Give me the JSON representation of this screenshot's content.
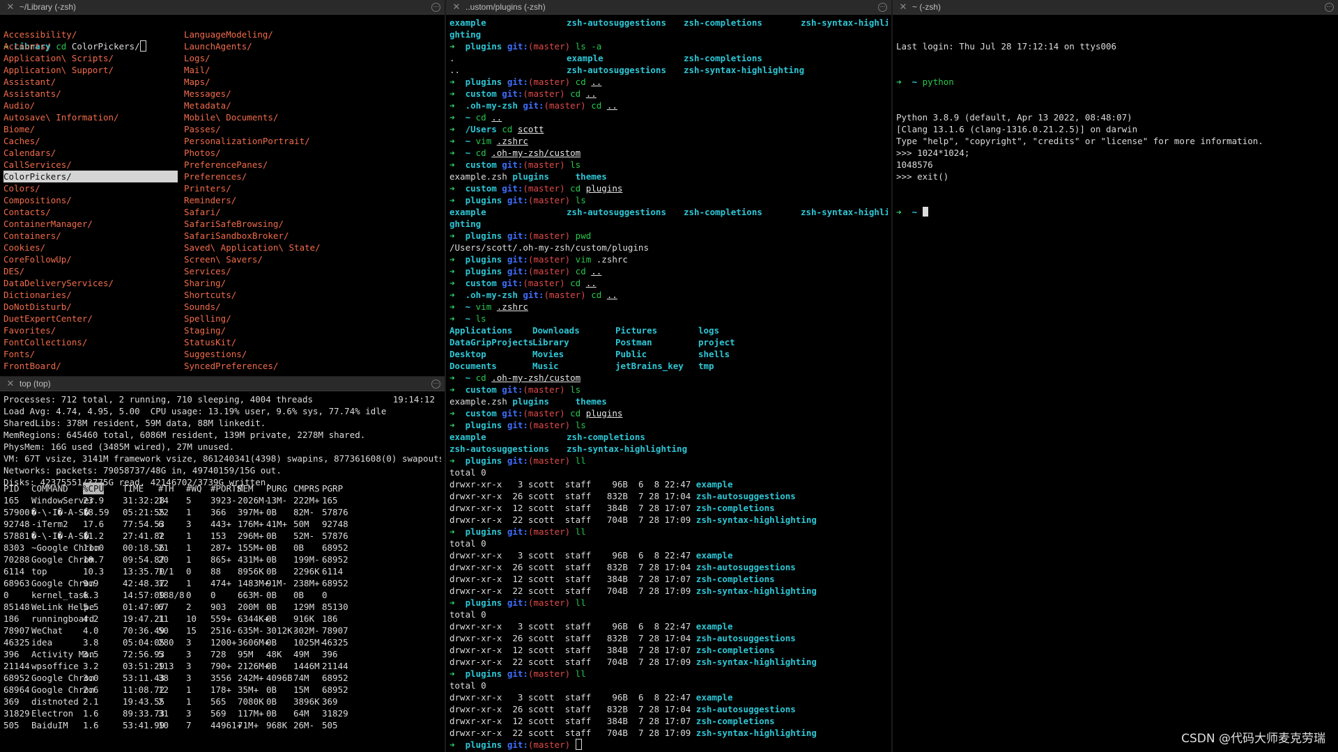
{
  "panes": {
    "library": {
      "title": "~/Library (-zsh)"
    },
    "top": {
      "title": "top (top)"
    },
    "plugins": {
      "title": "..ustom/plugins (-zsh)"
    },
    "python": {
      "title": "~ (-zsh)"
    }
  },
  "library": {
    "prompt_dir": "Library",
    "prompt_cmd": "cd",
    "prompt_arg": "ColorPickers/",
    "col1": [
      "Accessibility/",
      "Accounts/",
      "Application\\ Scripts/",
      "Application\\ Support/",
      "Assistant/",
      "Assistants/",
      "Audio/",
      "Autosave\\ Information/",
      "Biome/",
      "Caches/",
      "Calendars/",
      "CallServices/",
      "ColorPickers/",
      "Colors/",
      "Compositions/",
      "Contacts/",
      "ContainerManager/",
      "Containers/",
      "Cookies/",
      "CoreFollowUp/",
      "DES/",
      "DataDeliveryServices/",
      "Dictionaries/",
      "DoNotDisturb/",
      "DuetExpertCenter/",
      "Favorites/",
      "FontCollections/",
      "Fonts/",
      "FrontBoard/"
    ],
    "col2": [
      "LanguageModeling/",
      "LaunchAgents/",
      "Logs/",
      "Mail/",
      "Maps/",
      "Messages/",
      "Metadata/",
      "Mobile\\ Documents/",
      "Passes/",
      "PersonalizationPortrait/",
      "Photos/",
      "PreferencePanes/",
      "Preferences/",
      "Printers/",
      "Reminders/",
      "Safari/",
      "SafariSafeBrowsing/",
      "SafariSandboxBroker/",
      "Saved\\ Application\\ State/",
      "Screen\\ Savers/",
      "Services/",
      "Sharing/",
      "Shortcuts/",
      "Sounds/",
      "Spelling/",
      "Staging/",
      "StatusKit/",
      "Suggestions/",
      "SyncedPreferences/"
    ],
    "selected_index": 12
  },
  "top": {
    "summary": [
      "Processes: 712 total, 2 running, 710 sleeping, 4004 threads",
      "Load Avg: 4.74, 4.95, 5.00  CPU usage: 13.19% user, 9.6% sys, 77.74% idle",
      "SharedLibs: 378M resident, 59M data, 88M linkedit.",
      "MemRegions: 645460 total, 6086M resident, 139M private, 2278M shared.",
      "PhysMem: 16G used (3485M wired), 27M unused.",
      "VM: 67T vsize, 3141M framework vsize, 861240341(4398) swapins, 877361608(0) swapouts.",
      "Networks: packets: 79058737/48G in, 49740159/15G out.",
      "Disks: 42375551/3775G read, 42146702/3739G written."
    ],
    "time": "19:14:12",
    "headers": [
      "PID",
      "COMMAND",
      "%CPU",
      "TIME",
      "#TH",
      "#WQ",
      "#PORTS",
      "MEM",
      "PURG",
      "CMPRS",
      "PGRP"
    ],
    "rows": [
      [
        "165",
        "WindowServer",
        "23.9",
        "31:32:28",
        "14",
        "5",
        "3923-",
        "2026M-",
        "13M-",
        "222M+",
        "165"
      ],
      [
        "57900",
        "�-\\-I�-A-S�",
        "18.59",
        "05:21:55",
        "22",
        "1",
        "366",
        "397M+",
        "0B",
        "82M-",
        "57876"
      ],
      [
        "92748",
        "-iTerm2",
        "17.6",
        "77:54.53",
        "6",
        "3",
        "443+",
        "176M+",
        "41M+",
        "50M",
        "92748"
      ],
      [
        "57881",
        "�-\\-I�-A-S�",
        "11.2",
        "27:41.82",
        "7",
        "1",
        "153",
        "296M+",
        "0B",
        "52M-",
        "57876"
      ],
      [
        "8303",
        "~Google Chrom",
        "11.0",
        "00:18.56",
        "21",
        "1",
        "287+",
        "155M+",
        "0B",
        "0B",
        "68952"
      ],
      [
        "70288",
        "Google Chrom",
        "10.7",
        "09:54.87",
        "20",
        "1",
        "865+",
        "431M+",
        "0B",
        "199M-",
        "68952"
      ],
      [
        "6114",
        "top",
        "10.3",
        "13:35.70",
        "1/1",
        "0",
        "88",
        "8956K",
        "0B",
        "2296K",
        "6114"
      ],
      [
        "68963",
        "Google Chrom",
        "9.9",
        "42:48.37",
        "12",
        "1",
        "474+",
        "1483M+",
        "91M-",
        "238M+",
        "68952"
      ],
      [
        "0",
        "kernel_task",
        "6.3",
        "14:57:09",
        "188/8",
        "0",
        "0",
        "663M-",
        "0B",
        "0B",
        "0"
      ],
      [
        "85148",
        "WeLink Helpe",
        "5.5",
        "01:47:07",
        "67",
        "2",
        "903",
        "200M",
        "0B",
        "129M",
        "85130"
      ],
      [
        "186",
        "runningboard",
        "4.2",
        "19:47.21",
        "11",
        "10",
        "559+",
        "6344K+",
        "0B",
        "916K",
        "186"
      ],
      [
        "78907",
        "WeChat",
        "4.0",
        "70:36.49",
        "50",
        "15",
        "2516-",
        "635M-",
        "3012K-",
        "302M-",
        "78907"
      ],
      [
        "46325",
        "idea",
        "3.8",
        "05:04:05",
        "280",
        "3",
        "1200+",
        "3606M+",
        "0B",
        "1025M-",
        "46325"
      ],
      [
        "396",
        "Activity Mon",
        "3.5",
        "72:56.93",
        "5",
        "3",
        "728",
        "95M",
        "48K",
        "49M",
        "396"
      ],
      [
        "21144",
        "wpsoffice",
        "3.2",
        "03:51:29",
        "113",
        "3",
        "790+",
        "2126M+",
        "0B",
        "1446M",
        "21144"
      ],
      [
        "68952",
        "Google Chrom",
        "3.0",
        "53:11.43",
        "38",
        "3",
        "3556",
        "242M+",
        "4096B",
        "74M",
        "68952"
      ],
      [
        "68964",
        "Google Chrom",
        "2.6",
        "11:08.72",
        "12",
        "1",
        "178+",
        "35M+",
        "0B",
        "15M",
        "68952"
      ],
      [
        "369",
        "distnoted",
        "2.1",
        "19:43.55",
        "2",
        "1",
        "565",
        "7080K",
        "0B",
        "3896K",
        "369"
      ],
      [
        "31829",
        "Electron",
        "1.6",
        "89:33.73",
        "31",
        "3",
        "569",
        "117M+",
        "0B",
        "64M",
        "31829"
      ],
      [
        "505",
        "BaiduIM",
        "1.6",
        "53:41.99",
        "10",
        "7",
        "44961+",
        "71M+",
        "968K",
        "26M-",
        "505"
      ]
    ]
  },
  "plugins": {
    "head_ls_a": [
      "example",
      "zsh-autosuggestions",
      "zsh-completions",
      "zsh-syntax-highli"
    ],
    "head_wrap": "ghting",
    "lines": [
      {
        "t": "p",
        "dir": "plugins",
        "git": true,
        "cmd": "ls -a"
      },
      {
        "t": "ls4",
        "items": [
          ".",
          "example",
          "zsh-completions",
          ""
        ]
      },
      {
        "t": "ls4",
        "items": [
          "..",
          "zsh-autosuggestions",
          "zsh-syntax-highlighting",
          ""
        ]
      },
      {
        "t": "p",
        "dir": "plugins",
        "git": true,
        "cmd": "cd",
        "arg": ".."
      },
      {
        "t": "p",
        "dir": "custom",
        "git": true,
        "cmd": "cd",
        "arg": ".."
      },
      {
        "t": "p",
        "dir": ".oh-my-zsh",
        "git": true,
        "cmd": "cd",
        "arg": ".."
      },
      {
        "t": "p",
        "dir": "~",
        "cmd": "cd",
        "arg": ".."
      },
      {
        "t": "p",
        "dir": "/Users",
        "cmd": "cd",
        "arg": "scott"
      },
      {
        "t": "p",
        "dir": "~",
        "cmd": "vim",
        "arg": ".zshrc"
      },
      {
        "t": "p",
        "dir": "~",
        "cmd": "cd",
        "arg": ".oh-my-zsh/custom"
      },
      {
        "t": "p",
        "dir": "custom",
        "git": true,
        "cmd": "ls"
      },
      {
        "t": "mix",
        "parts": [
          "example.zsh ",
          "plugins",
          "themes"
        ]
      },
      {
        "t": "p",
        "dir": "custom",
        "git": true,
        "cmd": "cd",
        "arg": "plugins"
      },
      {
        "t": "p",
        "dir": "plugins",
        "git": true,
        "cmd": "ls"
      },
      {
        "t": "ls4",
        "items": [
          "example",
          "zsh-autosuggestions",
          "zsh-completions",
          "zsh-syntax-highli"
        ]
      },
      {
        "t": "dirtxt",
        "text": "ghting"
      },
      {
        "t": "p",
        "dir": "plugins",
        "git": true,
        "cmd": "pwd"
      },
      {
        "t": "txt",
        "text": "/Users/scott/.oh-my-zsh/custom/plugins"
      },
      {
        "t": "p",
        "dir": "plugins",
        "git": true,
        "cmd": "vim",
        "arg": ".zshrc",
        "argplain": true
      },
      {
        "t": "p",
        "dir": "plugins",
        "git": true,
        "cmd": "cd",
        "arg": ".."
      },
      {
        "t": "p",
        "dir": "custom",
        "git": true,
        "cmd": "cd",
        "arg": ".."
      },
      {
        "t": "p",
        "dir": ".oh-my-zsh",
        "git": true,
        "cmd": "cd",
        "arg": ".."
      },
      {
        "t": "p",
        "dir": "~",
        "cmd": "vim",
        "arg": ".zshrc"
      },
      {
        "t": "p",
        "dir": "~",
        "cmd": "ls"
      },
      {
        "t": "ls4",
        "items": [
          "Applications",
          "Downloads",
          "Pictures",
          "logs"
        ]
      },
      {
        "t": "ls4",
        "items": [
          "DataGripProjects",
          "Library",
          "Postman",
          "project"
        ]
      },
      {
        "t": "ls4",
        "items": [
          "Desktop",
          "Movies",
          "Public",
          "shells"
        ]
      },
      {
        "t": "ls4",
        "items": [
          "Documents",
          "Music",
          "jetBrains_key",
          "tmp"
        ]
      },
      {
        "t": "p",
        "dir": "~",
        "cmd": "cd",
        "arg": ".oh-my-zsh/custom"
      },
      {
        "t": "p",
        "dir": "custom",
        "git": true,
        "cmd": "ls"
      },
      {
        "t": "mix",
        "parts": [
          "example.zsh ",
          "plugins",
          "themes"
        ]
      },
      {
        "t": "p",
        "dir": "custom",
        "git": true,
        "cmd": "cd",
        "arg": "plugins"
      },
      {
        "t": "p",
        "dir": "plugins",
        "git": true,
        "cmd": "ls"
      },
      {
        "t": "ls2",
        "items": [
          "example",
          "zsh-completions"
        ]
      },
      {
        "t": "ls2",
        "items": [
          "zsh-autosuggestions",
          "zsh-syntax-highlighting"
        ]
      },
      {
        "t": "p",
        "dir": "plugins",
        "git": true,
        "cmd": "ll"
      },
      {
        "t": "txt",
        "text": "total 0"
      },
      {
        "t": "ll",
        "perm": "drwxr-xr-x",
        "n": "3",
        "user": "scott",
        "grp": "staff",
        "size": "96B",
        "date": "6  8 22:47",
        "name": "example"
      },
      {
        "t": "ll",
        "perm": "drwxr-xr-x",
        "n": "26",
        "user": "scott",
        "grp": "staff",
        "size": "832B",
        "date": "7 28 17:04",
        "name": "zsh-autosuggestions"
      },
      {
        "t": "ll",
        "perm": "drwxr-xr-x",
        "n": "12",
        "user": "scott",
        "grp": "staff",
        "size": "384B",
        "date": "7 28 17:07",
        "name": "zsh-completions"
      },
      {
        "t": "ll",
        "perm": "drwxr-xr-x",
        "n": "22",
        "user": "scott",
        "grp": "staff",
        "size": "704B",
        "date": "7 28 17:09",
        "name": "zsh-syntax-highlighting"
      },
      {
        "t": "p",
        "dir": "plugins",
        "git": true,
        "cmd": "ll"
      },
      {
        "t": "txt",
        "text": "total 0"
      },
      {
        "t": "ll",
        "perm": "drwxr-xr-x",
        "n": "3",
        "user": "scott",
        "grp": "staff",
        "size": "96B",
        "date": "6  8 22:47",
        "name": "example"
      },
      {
        "t": "ll",
        "perm": "drwxr-xr-x",
        "n": "26",
        "user": "scott",
        "grp": "staff",
        "size": "832B",
        "date": "7 28 17:04",
        "name": "zsh-autosuggestions"
      },
      {
        "t": "ll",
        "perm": "drwxr-xr-x",
        "n": "12",
        "user": "scott",
        "grp": "staff",
        "size": "384B",
        "date": "7 28 17:07",
        "name": "zsh-completions"
      },
      {
        "t": "ll",
        "perm": "drwxr-xr-x",
        "n": "22",
        "user": "scott",
        "grp": "staff",
        "size": "704B",
        "date": "7 28 17:09",
        "name": "zsh-syntax-highlighting"
      },
      {
        "t": "p",
        "dir": "plugins",
        "git": true,
        "cmd": "ll"
      },
      {
        "t": "txt",
        "text": "total 0"
      },
      {
        "t": "ll",
        "perm": "drwxr-xr-x",
        "n": "3",
        "user": "scott",
        "grp": "staff",
        "size": "96B",
        "date": "6  8 22:47",
        "name": "example"
      },
      {
        "t": "ll",
        "perm": "drwxr-xr-x",
        "n": "26",
        "user": "scott",
        "grp": "staff",
        "size": "832B",
        "date": "7 28 17:04",
        "name": "zsh-autosuggestions"
      },
      {
        "t": "ll",
        "perm": "drwxr-xr-x",
        "n": "12",
        "user": "scott",
        "grp": "staff",
        "size": "384B",
        "date": "7 28 17:07",
        "name": "zsh-completions"
      },
      {
        "t": "ll",
        "perm": "drwxr-xr-x",
        "n": "22",
        "user": "scott",
        "grp": "staff",
        "size": "704B",
        "date": "7 28 17:09",
        "name": "zsh-syntax-highlighting"
      },
      {
        "t": "p",
        "dir": "plugins",
        "git": true,
        "cmd": "ll"
      },
      {
        "t": "txt",
        "text": "total 0"
      },
      {
        "t": "ll",
        "perm": "drwxr-xr-x",
        "n": "3",
        "user": "scott",
        "grp": "staff",
        "size": "96B",
        "date": "6  8 22:47",
        "name": "example"
      },
      {
        "t": "ll",
        "perm": "drwxr-xr-x",
        "n": "26",
        "user": "scott",
        "grp": "staff",
        "size": "832B",
        "date": "7 28 17:04",
        "name": "zsh-autosuggestions"
      },
      {
        "t": "ll",
        "perm": "drwxr-xr-x",
        "n": "12",
        "user": "scott",
        "grp": "staff",
        "size": "384B",
        "date": "7 28 17:07",
        "name": "zsh-completions"
      },
      {
        "t": "ll",
        "perm": "drwxr-xr-x",
        "n": "22",
        "user": "scott",
        "grp": "staff",
        "size": "704B",
        "date": "7 28 17:09",
        "name": "zsh-syntax-highlighting"
      },
      {
        "t": "pcur",
        "dir": "plugins",
        "git": true
      }
    ],
    "git_label": "git:",
    "git_branch": "(master)"
  },
  "python": {
    "last_login": "Last login: Thu Jul 28 17:12:14 on ttys006",
    "prompt1_dir": "~",
    "prompt1_cmd": "python",
    "lines": [
      "Python 3.8.9 (default, Apr 13 2022, 08:48:07)",
      "[Clang 13.1.6 (clang-1316.0.21.2.5)] on darwin",
      "Type \"help\", \"copyright\", \"credits\" or \"license\" for more information.",
      ">>> 1024*1024;",
      "1048576",
      ">>> exit()"
    ],
    "prompt2_dir": "~"
  },
  "prompt_arrow": "➜",
  "watermark": "CSDN @代码大师麦克劳瑞",
  "colors": {
    "prompt": "#2fd46a",
    "dir": "#2ec7d6",
    "branch": "#e34a4a",
    "folder": "#f26b4a"
  }
}
